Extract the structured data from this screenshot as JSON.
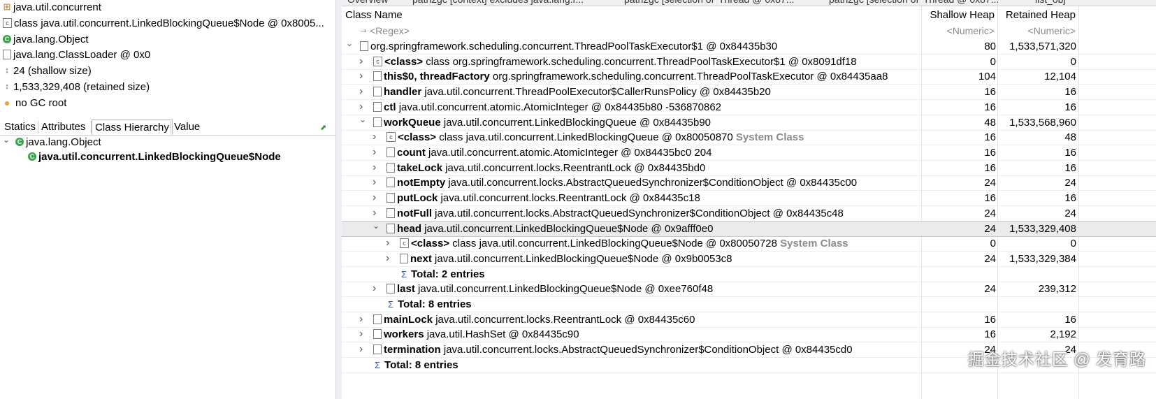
{
  "left_panel": {
    "info_rows": [
      {
        "icon": "grid",
        "text": "java.util.concurrent"
      },
      {
        "icon": "class",
        "text": "class java.util.concurrent.LinkedBlockingQueue$Node @ 0x8005..."
      },
      {
        "icon": "object",
        "text": "java.lang.Object"
      },
      {
        "icon": "field",
        "text": "java.lang.ClassLoader @ 0x0"
      },
      {
        "icon": "size",
        "text": "24 (shallow size)"
      },
      {
        "icon": "size",
        "text": "1,533,329,408 (retained size)"
      },
      {
        "icon": "dot",
        "text": "no GC root"
      }
    ],
    "tabs": [
      "Statics",
      "Attributes",
      "Class Hierarchy",
      "Value"
    ],
    "active_tab": "Class Hierarchy",
    "hierarchy": [
      {
        "text": "java.lang.Object",
        "bold": false
      },
      {
        "text": "java.util.concurrent.LinkedBlockingQueue$Node",
        "bold": true
      }
    ]
  },
  "top_tabs": [
    "Overview",
    "path2gc [context] excludes java.lang.r...",
    "path2gc [selection of 'Thread @ 0x87...",
    "path2gc [selection of 'Thread @ 0x87...",
    "list_obj"
  ],
  "table": {
    "headers": {
      "class_name": "Class Name",
      "shallow": "Shallow Heap",
      "retained": "Retained Heap"
    },
    "filters": {
      "class_name": "<Regex>",
      "shallow": "<Numeric>",
      "retained": "<Numeric>"
    },
    "rows": [
      {
        "level": 0,
        "expanded": true,
        "icon": "field",
        "field": "",
        "text": "org.springframework.scheduling.concurrent.ThreadPoolTaskExecutor$1 @ 0x84435b30",
        "sys": "",
        "shallow": "80",
        "retained": "1,533,571,320"
      },
      {
        "level": 1,
        "expanded": false,
        "icon": "class",
        "field": "<class>",
        "text": "class org.springframework.scheduling.concurrent.ThreadPoolTaskExecutor$1 @ 0x8091df18",
        "sys": "",
        "shallow": "0",
        "retained": "0"
      },
      {
        "level": 1,
        "expanded": false,
        "icon": "field",
        "field": "this$0, threadFactory",
        "text": "org.springframework.scheduling.concurrent.ThreadPoolTaskExecutor @ 0x84435aa8",
        "sys": "",
        "shallow": "104",
        "retained": "12,104"
      },
      {
        "level": 1,
        "expanded": false,
        "icon": "field",
        "field": "handler",
        "text": "java.util.concurrent.ThreadPoolExecutor$CallerRunsPolicy @ 0x84435b20",
        "sys": "",
        "shallow": "16",
        "retained": "16"
      },
      {
        "level": 1,
        "expanded": false,
        "icon": "field",
        "field": "ctl",
        "text": "java.util.concurrent.atomic.AtomicInteger @ 0x84435b80  -536870862",
        "sys": "",
        "shallow": "16",
        "retained": "16"
      },
      {
        "level": 1,
        "expanded": true,
        "icon": "field",
        "field": "workQueue",
        "text": "java.util.concurrent.LinkedBlockingQueue @ 0x84435b90",
        "sys": "",
        "shallow": "48",
        "retained": "1,533,568,960"
      },
      {
        "level": 2,
        "expanded": false,
        "icon": "class",
        "field": "<class>",
        "text": "class java.util.concurrent.LinkedBlockingQueue @ 0x80050870",
        "sys": "System Class",
        "shallow": "16",
        "retained": "48"
      },
      {
        "level": 2,
        "expanded": false,
        "icon": "field",
        "field": "count",
        "text": "java.util.concurrent.atomic.AtomicInteger @ 0x84435bc0  204",
        "sys": "",
        "shallow": "16",
        "retained": "16"
      },
      {
        "level": 2,
        "expanded": false,
        "icon": "field",
        "field": "takeLock",
        "text": "java.util.concurrent.locks.ReentrantLock @ 0x84435bd0",
        "sys": "",
        "shallow": "16",
        "retained": "16"
      },
      {
        "level": 2,
        "expanded": false,
        "icon": "field",
        "field": "notEmpty",
        "text": "java.util.concurrent.locks.AbstractQueuedSynchronizer$ConditionObject @ 0x84435c00",
        "sys": "",
        "shallow": "24",
        "retained": "24"
      },
      {
        "level": 2,
        "expanded": false,
        "icon": "field",
        "field": "putLock",
        "text": "java.util.concurrent.locks.ReentrantLock @ 0x84435c18",
        "sys": "",
        "shallow": "16",
        "retained": "16"
      },
      {
        "level": 2,
        "expanded": false,
        "icon": "field",
        "field": "notFull",
        "text": "java.util.concurrent.locks.AbstractQueuedSynchronizer$ConditionObject @ 0x84435c48",
        "sys": "",
        "shallow": "24",
        "retained": "24"
      },
      {
        "level": 2,
        "expanded": true,
        "selected": true,
        "icon": "field",
        "field": "head",
        "text": "java.util.concurrent.LinkedBlockingQueue$Node @ 0x9afff0e0",
        "sys": "",
        "shallow": "24",
        "retained": "1,533,329,408"
      },
      {
        "level": 3,
        "expanded": false,
        "icon": "class",
        "field": "<class>",
        "text": "class java.util.concurrent.LinkedBlockingQueue$Node @ 0x80050728",
        "sys": "System Class",
        "shallow": "0",
        "retained": "0"
      },
      {
        "level": 3,
        "expanded": false,
        "icon": "field",
        "field": "next",
        "text": "java.util.concurrent.LinkedBlockingQueue$Node @ 0x9b0053c8",
        "sys": "",
        "shallow": "24",
        "retained": "1,533,329,384"
      },
      {
        "level": 3,
        "total": true,
        "text": "Total: 2 entries"
      },
      {
        "level": 2,
        "expanded": false,
        "icon": "field",
        "field": "last",
        "text": "java.util.concurrent.LinkedBlockingQueue$Node @ 0xee760f48",
        "sys": "",
        "shallow": "24",
        "retained": "239,312"
      },
      {
        "level": 2,
        "total": true,
        "text": "Total: 8 entries"
      },
      {
        "level": 1,
        "expanded": false,
        "icon": "field",
        "field": "mainLock",
        "text": "java.util.concurrent.locks.ReentrantLock @ 0x84435c60",
        "sys": "",
        "shallow": "16",
        "retained": "16"
      },
      {
        "level": 1,
        "expanded": false,
        "icon": "field",
        "field": "workers",
        "text": "java.util.HashSet @ 0x84435c90",
        "sys": "",
        "shallow": "16",
        "retained": "2,192"
      },
      {
        "level": 1,
        "expanded": false,
        "icon": "field",
        "field": "termination",
        "text": "java.util.concurrent.locks.AbstractQueuedSynchronizer$ConditionObject @ 0x84435cd0",
        "sys": "",
        "shallow": "24",
        "retained": "24"
      },
      {
        "level": 1,
        "total": true,
        "text": "Total: 8 entries"
      }
    ]
  },
  "watermark": "掘金技术社区 @ 发育路"
}
